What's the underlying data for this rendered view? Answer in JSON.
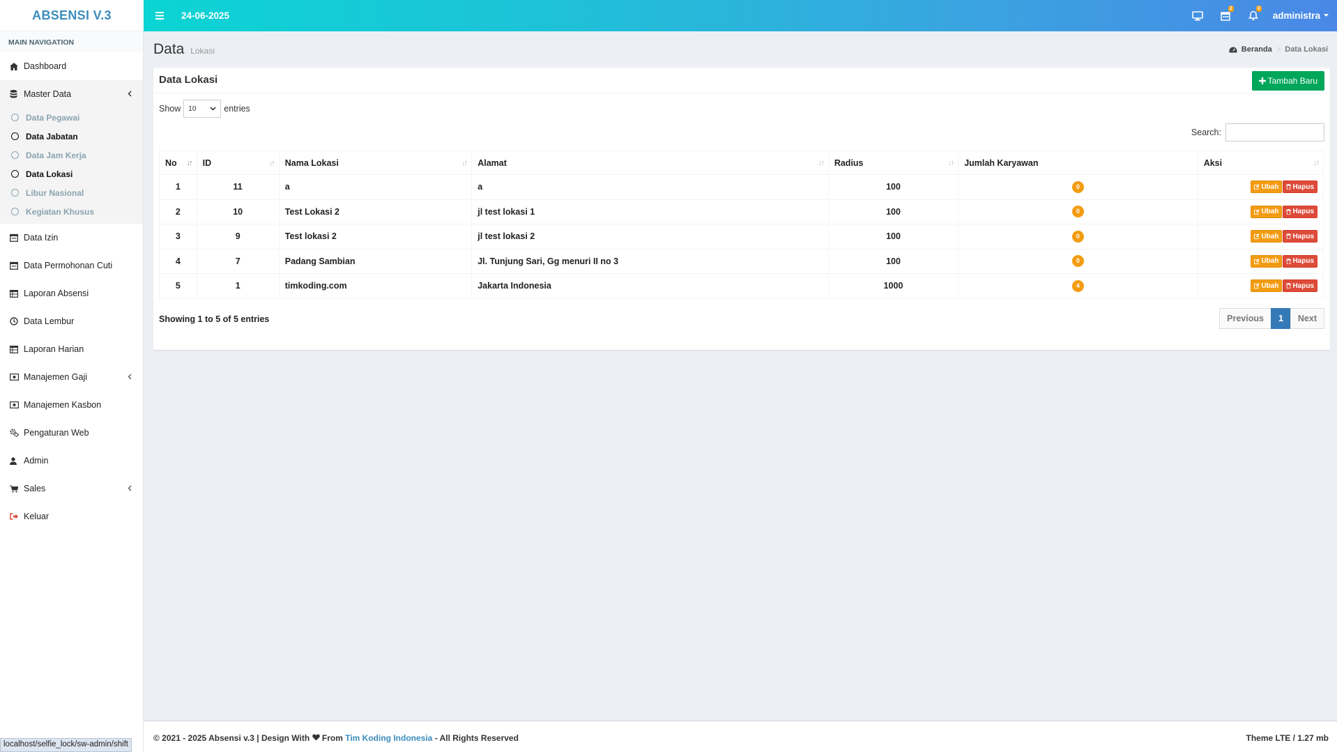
{
  "app": {
    "brand": "ABSENSI V.3",
    "date": "24-06-2025",
    "user": "administra",
    "nav_badges": {
      "calendar": "2",
      "bell": "0"
    }
  },
  "sidebar": {
    "header": "MAIN NAVIGATION",
    "items": [
      {
        "label": "Dashboard",
        "icon": "home-icon"
      },
      {
        "label": "Master Data",
        "icon": "database-icon"
      },
      {
        "label": "Data Izin",
        "icon": "calendar-icon"
      },
      {
        "label": "Data Permohonan Cuti",
        "icon": "calendar-icon"
      },
      {
        "label": "Laporan Absensi",
        "icon": "table-icon"
      },
      {
        "label": "Data Lembur",
        "icon": "clock-icon"
      },
      {
        "label": "Laporan Harian",
        "icon": "table-icon"
      },
      {
        "label": "Manajemen Gaji",
        "icon": "money-icon"
      },
      {
        "label": "Manajemen Kasbon",
        "icon": "money-icon"
      },
      {
        "label": "Pengaturan Web",
        "icon": "gears-icon"
      },
      {
        "label": "Admin",
        "icon": "user-icon"
      },
      {
        "label": "Sales",
        "icon": "cart-icon"
      },
      {
        "label": "Keluar",
        "icon": "sign-out-icon"
      }
    ],
    "master_sub": [
      "Data Pegawai",
      "Data Jabatan",
      "Data Jam Kerja",
      "Data Lokasi",
      "Libur Nasional",
      "Kegiatan Khusus"
    ]
  },
  "page": {
    "title": "Data",
    "subtitle": "Lokasi",
    "breadcrumb_home": "Beranda",
    "breadcrumb_current": "Data Lokasi"
  },
  "box": {
    "title": "Data Lokasi",
    "add_button": "Tambah Baru",
    "show_label": "Show",
    "entries_label": "entries",
    "length_value": "10",
    "search_label": "Search:",
    "info": "Showing 1 to 5 of 5 entries",
    "pagination": {
      "previous": "Previous",
      "page": "1",
      "next": "Next"
    }
  },
  "table": {
    "headers": [
      "No",
      "ID",
      "Nama Lokasi",
      "Alamat",
      "Radius",
      "Jumlah Karyawan",
      "Aksi"
    ],
    "rows": [
      {
        "no": "1",
        "id": "11",
        "nama": "a",
        "alamat": "a",
        "radius": "100",
        "jumlah": "0"
      },
      {
        "no": "2",
        "id": "10",
        "nama": "Test Lokasi 2",
        "alamat": "jl test lokasi 1",
        "radius": "100",
        "jumlah": "0"
      },
      {
        "no": "3",
        "id": "9",
        "nama": "Test lokasi 2",
        "alamat": "jl test lokasi 2",
        "radius": "100",
        "jumlah": "0"
      },
      {
        "no": "4",
        "id": "7",
        "nama": "Padang Sambian",
        "alamat": "Jl. Tunjung Sari, Gg menuri II no 3",
        "radius": "100",
        "jumlah": "0"
      },
      {
        "no": "5",
        "id": "1",
        "nama": "timkoding.com",
        "alamat": "Jakarta Indonesia",
        "radius": "1000",
        "jumlah": "4"
      }
    ],
    "action_edit": "Ubah",
    "action_delete": "Hapus"
  },
  "footer": {
    "left_prefix": "© 2021 - 2025 Absensi v.3 | Design With",
    "left_from": "From",
    "left_link": "Tim Koding Indonesia",
    "left_suffix": "- All Rights Reserved",
    "right": "Theme LTE / 1.27 mb"
  },
  "status_url": "localhost/selfie_lock/sw-admin/shift"
}
